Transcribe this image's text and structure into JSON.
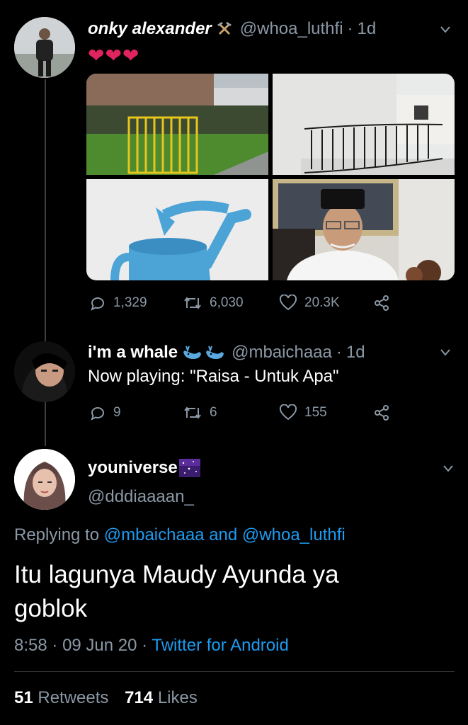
{
  "tweet1": {
    "display_name": "onky alexander",
    "name_emoji": "⚒",
    "handle": "@whoa_luthfi",
    "separator": "·",
    "time": "1d",
    "body_emoji": "❤❤❤",
    "stats": {
      "replies": "1,329",
      "retweets": "6,030",
      "likes": "20.3K"
    }
  },
  "tweet2": {
    "display_name": "i'm a whale",
    "name_emoji": "🐳🐳",
    "handle": "@mbaichaaa",
    "separator": "·",
    "time": "1d",
    "text": "Now playing: \"Raisa - Untuk Apa\"",
    "stats": {
      "replies": "9",
      "retweets": "6",
      "likes": "155"
    }
  },
  "main": {
    "display_name": "youniverse",
    "handle": "@dddiaaaan_",
    "replying_prefix": "Replying to",
    "reply_to_1": "@mbaichaaa",
    "reply_and": "and",
    "reply_to_2": "@whoa_luthfi",
    "text_line1": "Itu lagunya Maudy Ayunda ya",
    "text_line2": "goblok",
    "time": "8:58",
    "date": "09 Jun 20",
    "sep": "·",
    "client": "Twitter for Android",
    "retweets_count": "51",
    "retweets_label": "Retweets",
    "likes_count": "714",
    "likes_label": "Likes"
  },
  "colors": {
    "background": "#000000",
    "muted": "#8b98a5",
    "link": "#1d9bf0",
    "heart": "#e0245e",
    "divider": "#2f3336"
  },
  "icons": [
    "reply-icon",
    "retweet-icon",
    "like-icon",
    "share-icon",
    "chevron-down-icon",
    "hammer-pick-icon",
    "whale-icon"
  ]
}
